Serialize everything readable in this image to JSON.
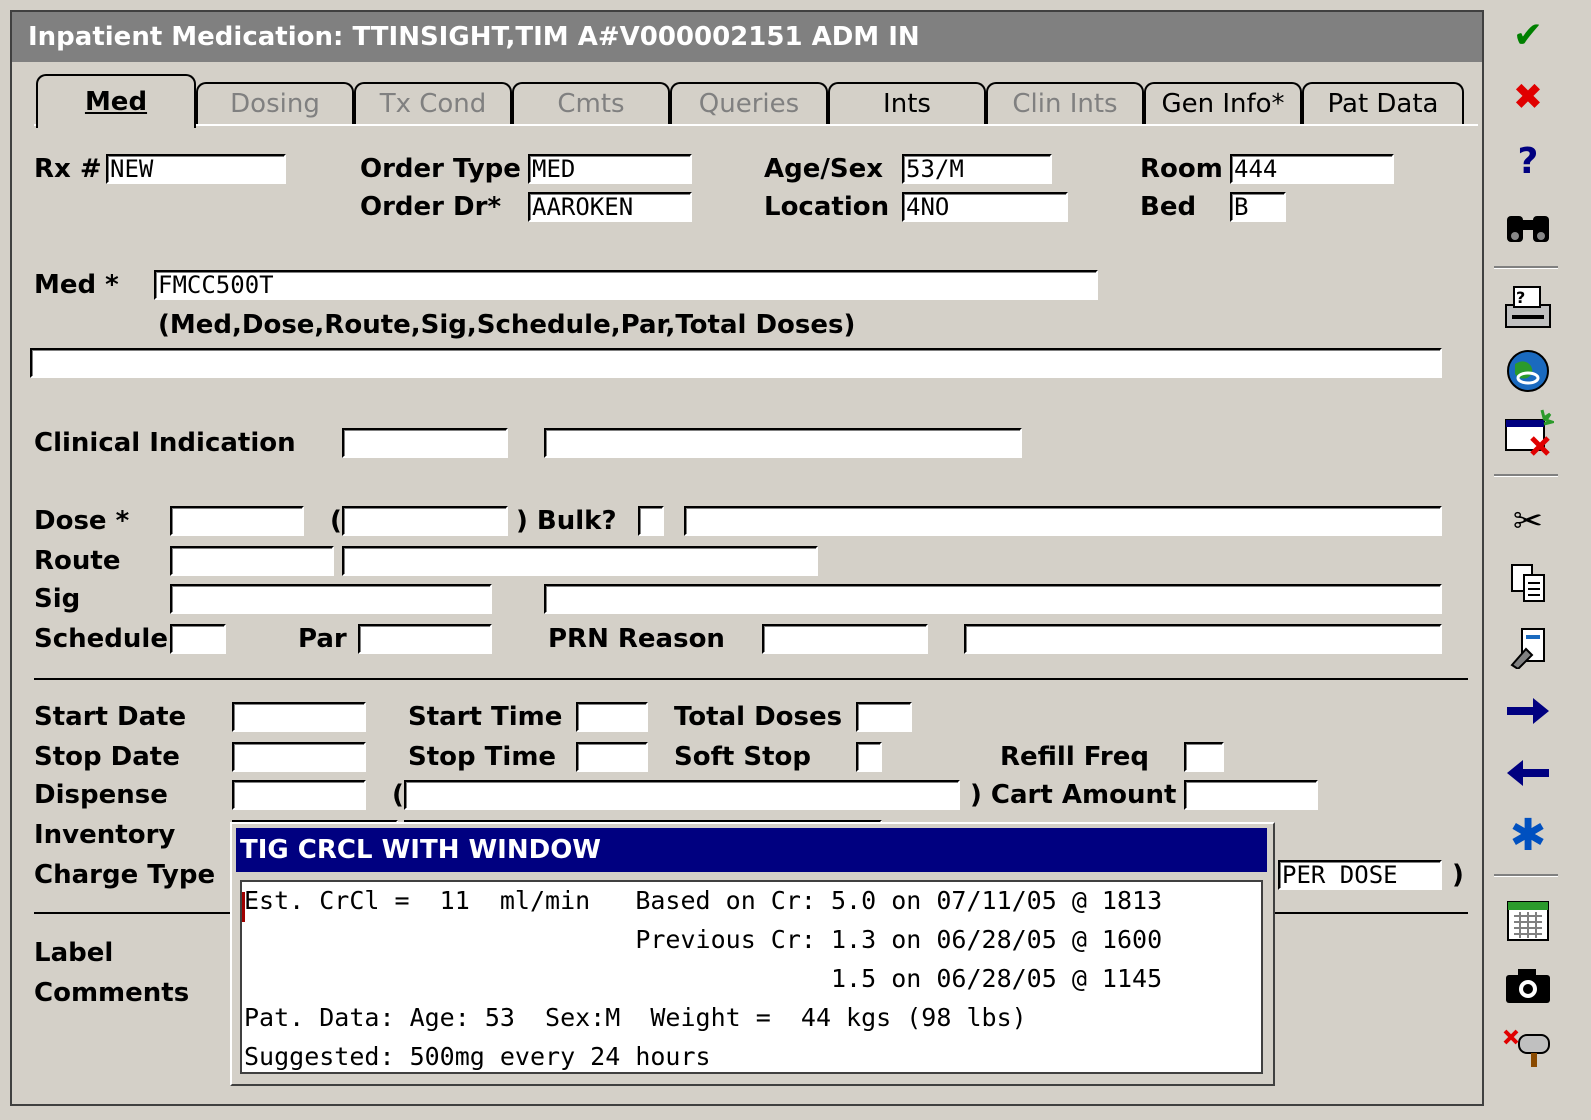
{
  "window": {
    "title": "Inpatient Medication:  TTINSIGHT,TIM A#V000002151 ADM IN"
  },
  "tabs": [
    {
      "label": "Med",
      "active": true
    },
    {
      "label": "Dosing",
      "active": false
    },
    {
      "label": "Tx Cond",
      "active": false
    },
    {
      "label": "Cmts",
      "active": false
    },
    {
      "label": "Queries",
      "active": false
    },
    {
      "label": "Ints",
      "active": false
    },
    {
      "label": "Clin Ints",
      "active": false
    },
    {
      "label": "Gen Info*",
      "active": false
    },
    {
      "label": "Pat Data",
      "active": false
    }
  ],
  "form": {
    "rx_label": "Rx #",
    "rx_value": "NEW",
    "order_type_label": "Order Type",
    "order_type_value": "MED",
    "order_dr_label": "Order Dr*",
    "order_dr_value": "AAROKEN",
    "age_sex_label": "Age/Sex",
    "age_sex_value": "53/M",
    "location_label": "Location",
    "location_value": "4NO",
    "room_label": "Room",
    "room_value": "444",
    "bed_label": "Bed",
    "bed_value": "B",
    "med_label": "Med *",
    "med_value": "FMCC500T",
    "med_hint": "(Med,Dose,Route,Sig,Schedule,Par,Total Doses)",
    "clinical_indication_label": "Clinical Indication",
    "dose_label": "Dose *",
    "paren_open": "(",
    "bulk_label": ") Bulk?",
    "route_label": "Route",
    "sig_label": "Sig",
    "schedule_label": "Schedule",
    "par_label": "Par",
    "prn_reason_label": "PRN Reason",
    "start_date_label": "Start Date",
    "start_time_label": "Start Time",
    "total_doses_label": "Total Doses",
    "stop_date_label": "Stop Date",
    "stop_time_label": "Stop Time",
    "soft_stop_label": "Soft Stop",
    "refill_freq_label": "Refill Freq",
    "dispense_label": "Dispense",
    "cart_amount_label": ") Cart Amount",
    "inventory_label": "Inventory",
    "charge_type_label": "Charge Type",
    "charge_type_value": "PER DOSE",
    "charge_close": ")",
    "label_label": "Label",
    "comments_label": "Comments"
  },
  "popup": {
    "title": "TIG CRCL WITH WINDOW",
    "lines": [
      "Est. CrCl =  11  ml/min   Based on Cr: 5.0 on 07/11/05 @ 1813",
      "                          Previous Cr: 1.3 on 06/28/05 @ 1600",
      "                                       1.5 on 06/28/05 @ 1145",
      "Pat. Data: Age: 53  Sex:M  Weight =  44 kgs (98 lbs)",
      "Suggested: 500mg every 24 hours"
    ]
  },
  "toolbar": {
    "icons": [
      "checkmark-icon",
      "cancel-x-icon",
      "help-question-icon",
      "binoculars-icon",
      "print-icon",
      "globe-link-icon",
      "calendar-delete-icon",
      "scissors-icon",
      "copy-icon",
      "paste-icon",
      "arrow-right-icon",
      "arrow-left-icon",
      "asterisk-icon",
      "grid-icon",
      "camera-icon",
      "mailbox-icon"
    ],
    "colors": {
      "check": "#008000",
      "cancel": "#e00000",
      "accent": "#000080"
    }
  }
}
